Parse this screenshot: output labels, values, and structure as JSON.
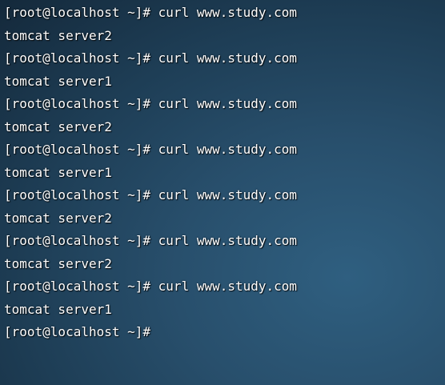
{
  "terminal": {
    "entries": [
      {
        "prompt": "[root@localhost ~]#",
        "command": " curl www.study.com",
        "output": "tomcat server2"
      },
      {
        "prompt": "[root@localhost ~]#",
        "command": " curl www.study.com",
        "output": "tomcat server1"
      },
      {
        "prompt": "[root@localhost ~]#",
        "command": " curl www.study.com",
        "output": "tomcat server2"
      },
      {
        "prompt": "[root@localhost ~]#",
        "command": " curl www.study.com",
        "output": "tomcat server1"
      },
      {
        "prompt": "[root@localhost ~]#",
        "command": " curl www.study.com",
        "output": "tomcat server2"
      },
      {
        "prompt": "[root@localhost ~]#",
        "command": " curl www.study.com",
        "output": "tomcat server2"
      },
      {
        "prompt": "[root@localhost ~]#",
        "command": " curl www.study.com",
        "output": "tomcat server1"
      }
    ],
    "final_prompt": "[root@localhost ~]#"
  },
  "colors": {
    "text": "#ffffff",
    "background": "#284f6c"
  }
}
